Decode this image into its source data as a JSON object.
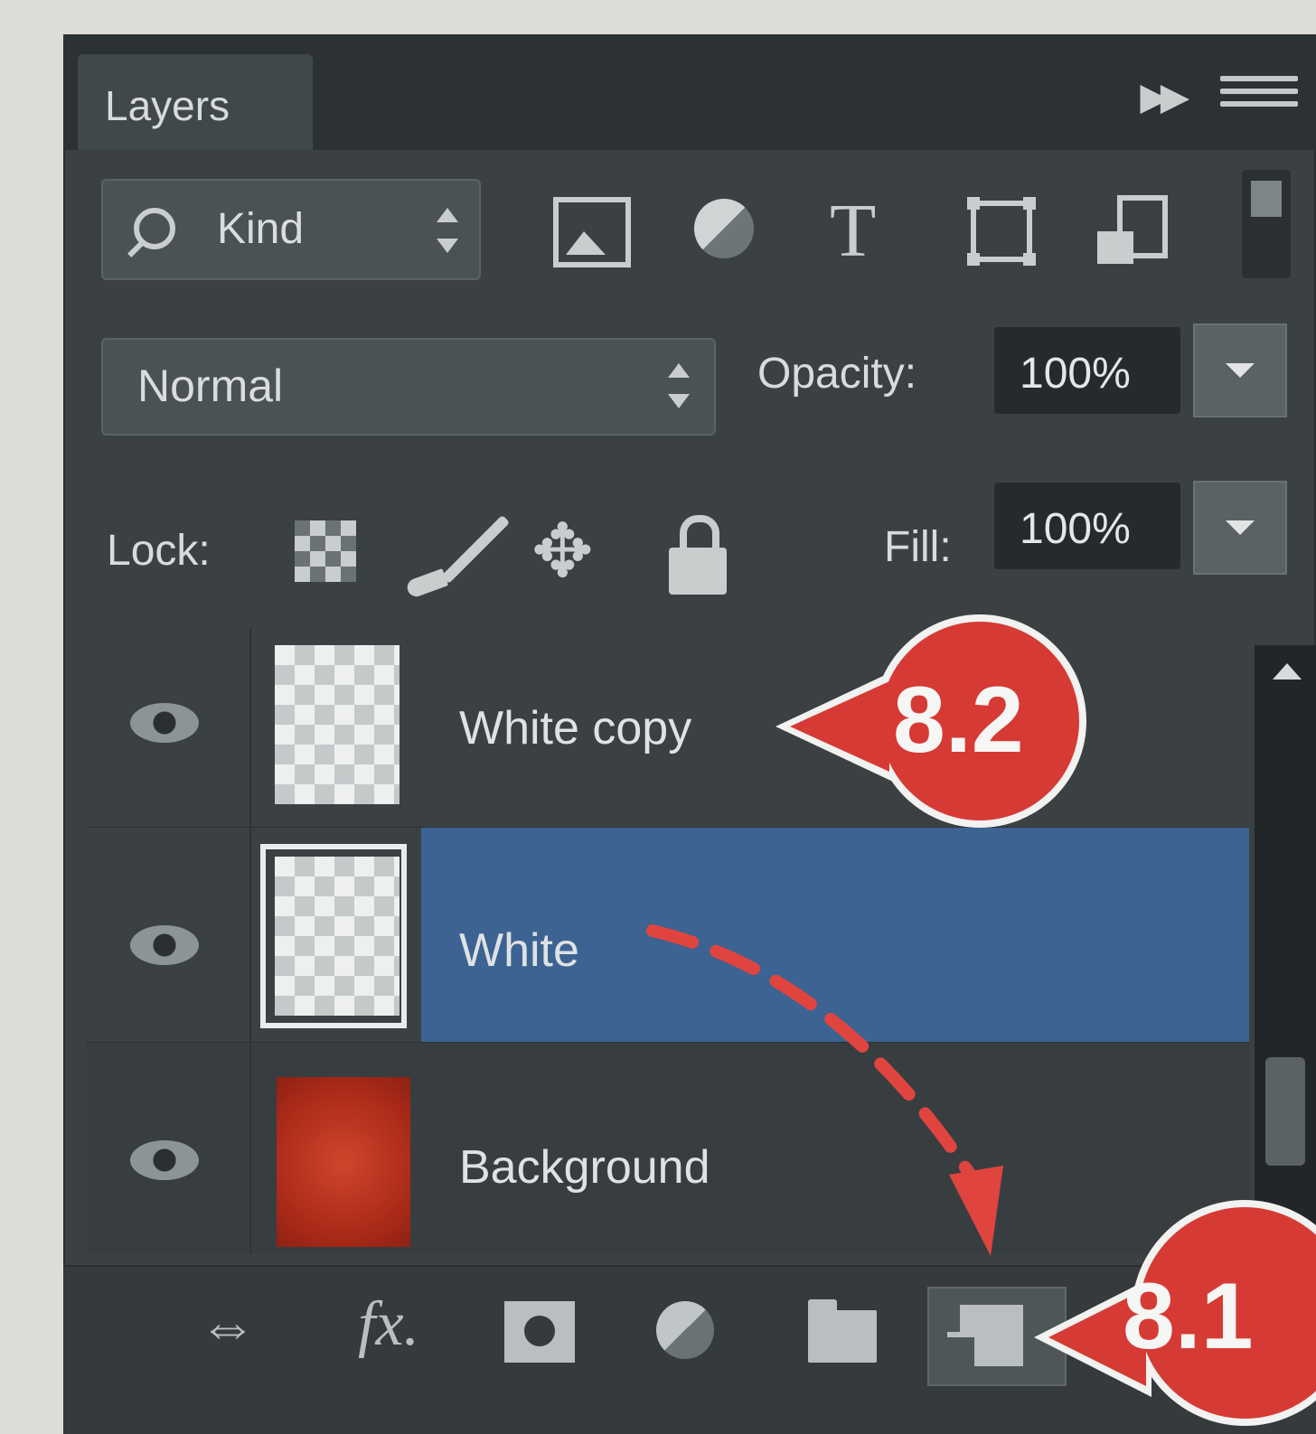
{
  "panel": {
    "tab_title": "Layers",
    "filter": {
      "kind_label": "Kind"
    },
    "blend_mode": "Normal",
    "opacity_label": "Opacity:",
    "opacity_value": "100%",
    "lock_label": "Lock:",
    "fill_label": "Fill:",
    "fill_value": "100%"
  },
  "layers": [
    {
      "name": "White copy",
      "visible": true,
      "selected": false,
      "thumbnail": "transparent"
    },
    {
      "name": "White",
      "visible": true,
      "selected": true,
      "thumbnail": "transparent"
    },
    {
      "name": "Background",
      "visible": true,
      "selected": false,
      "thumbnail": "red"
    }
  ],
  "footer_icons": [
    "link-icon",
    "fx-icon",
    "mask-icon",
    "adjustment-icon",
    "folder-icon",
    "new-layer-icon"
  ],
  "annotations": [
    {
      "label": "8.2"
    },
    {
      "label": "8.1"
    }
  ],
  "colors": {
    "panel_bg": "#3b4143",
    "selection": "#3c6392",
    "annotation_red": "#d63a35"
  }
}
